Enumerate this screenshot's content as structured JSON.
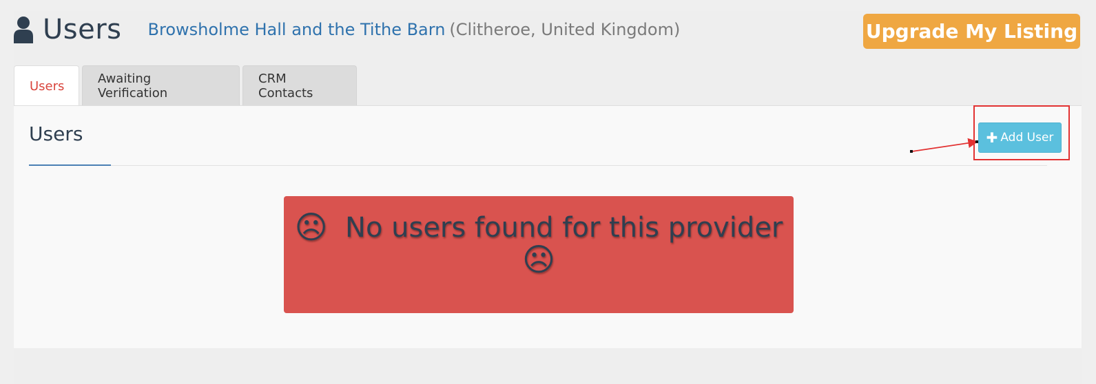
{
  "header": {
    "title": "Users",
    "venue_name": "Browsholme Hall and the Tithe Barn",
    "venue_location": "(Clitheroe, United Kingdom)",
    "upgrade_label": "Upgrade My Listing"
  },
  "tabs": [
    {
      "label": "Users",
      "active": true
    },
    {
      "label": "Awaiting Verification",
      "active": false
    },
    {
      "label": "CRM Contacts",
      "active": false
    }
  ],
  "panel": {
    "title": "Users",
    "add_user_label": "Add User",
    "add_user_icon": "plus-icon"
  },
  "alert": {
    "frown_left": "☹",
    "message": "No users found for this provider",
    "frown_right": "☹"
  },
  "colors": {
    "accent_orange": "#efa742",
    "info_blue": "#5bc0de",
    "danger_red": "#d9534f",
    "active_tab_red": "#d9453d",
    "link_blue": "#2f72ad",
    "annotation_red": "#e23131"
  }
}
